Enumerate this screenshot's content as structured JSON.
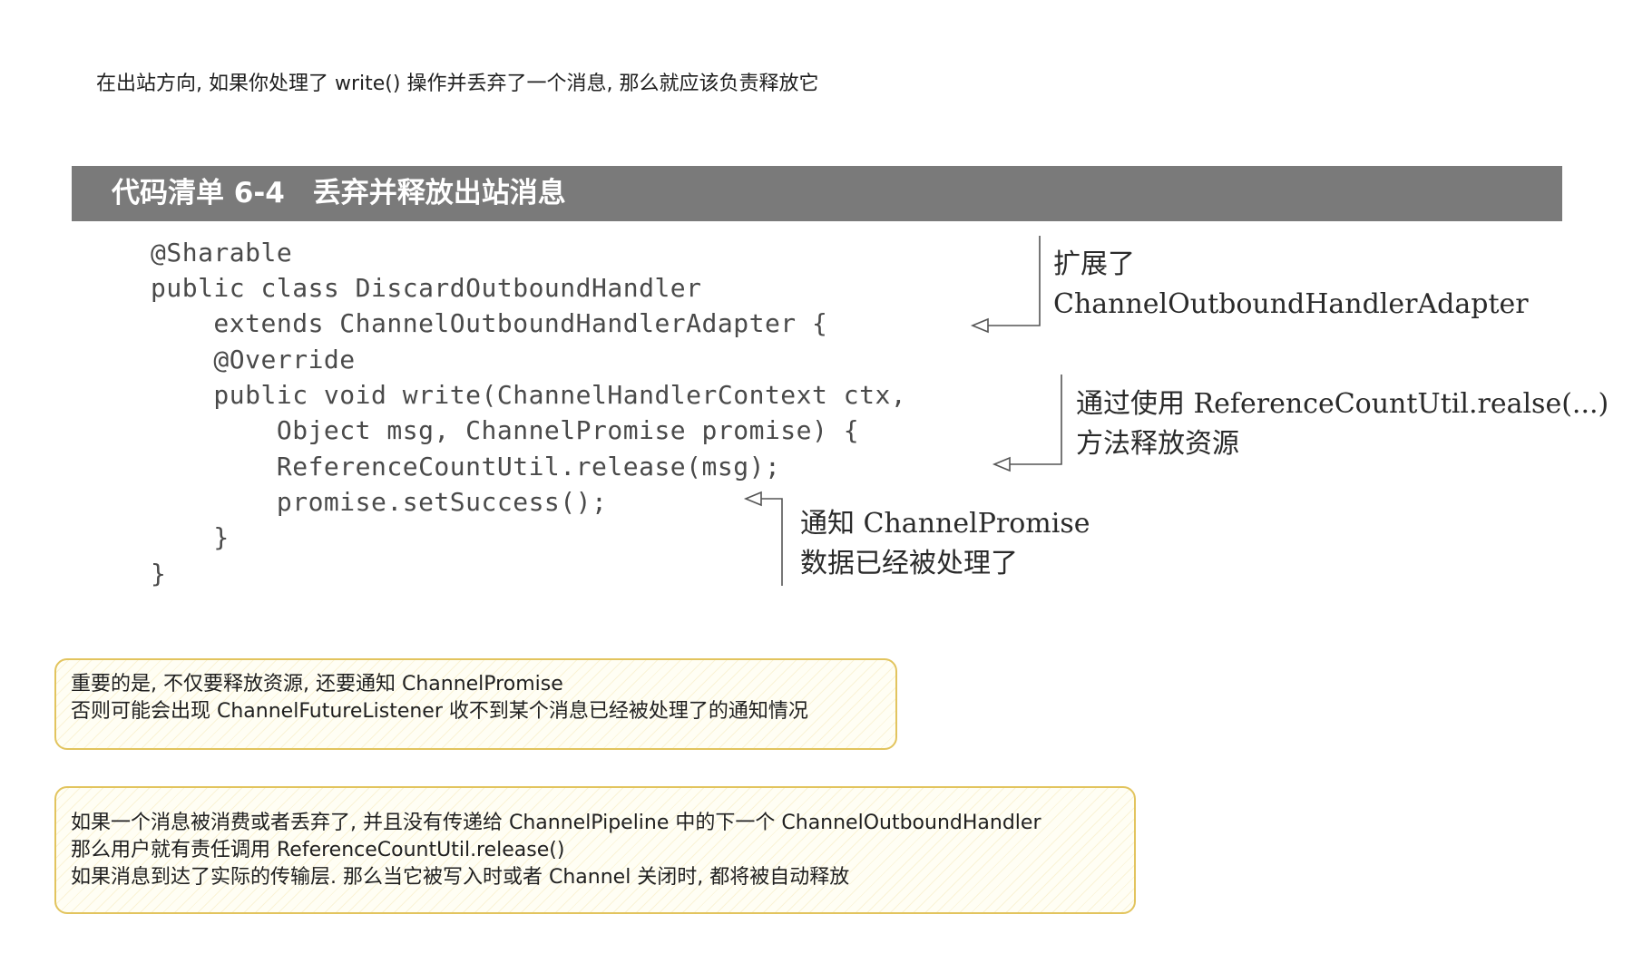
{
  "intro": "在出站方向, 如果你处理了 write() 操作并丢弃了一个消息, 那么就应该负责释放它",
  "listing": {
    "title": "代码清单 6-4　丢弃并释放出站消息",
    "code_lines": [
      "@Sharable",
      "public class DiscardOutboundHandler",
      "    extends ChannelOutboundHandlerAdapter {",
      "    @Override",
      "    public void write(ChannelHandlerContext ctx,",
      "        Object msg, ChannelPromise promise) {",
      "        ReferenceCountUtil.release(msg);",
      "        promise.setSuccess();",
      "    }",
      "}"
    ],
    "annotations": [
      {
        "line1": "扩展了",
        "line2": "ChannelOutboundHandlerAdapter"
      },
      {
        "line1": "通过使用  ReferenceCountUtil.realse(...)",
        "line2": "方法释放资源"
      },
      {
        "line1": "通知 ChannelPromise",
        "line2": "数据已经被处理了"
      }
    ]
  },
  "notes": [
    {
      "lines": [
        "重要的是, 不仅要释放资源, 还要通知 ChannelPromise",
        "否则可能会出现 ChannelFutureListener 收不到某个消息已经被处理了的通知情况"
      ]
    },
    {
      "lines": [
        "如果一个消息被消费或者丢弃了, 并且没有传递给 ChannelPipeline 中的下一个 ChannelOutboundHandler",
        "那么用户就有责任调用 ReferenceCountUtil.release()",
        "如果消息到达了实际的传输层. 那么当它被写入时或者 Channel 关闭时, 都将被自动释放"
      ]
    }
  ],
  "colors": {
    "header_bg": "#7a7a7a",
    "note_border": "#e2c45e",
    "note_bg": "#fffef4"
  }
}
